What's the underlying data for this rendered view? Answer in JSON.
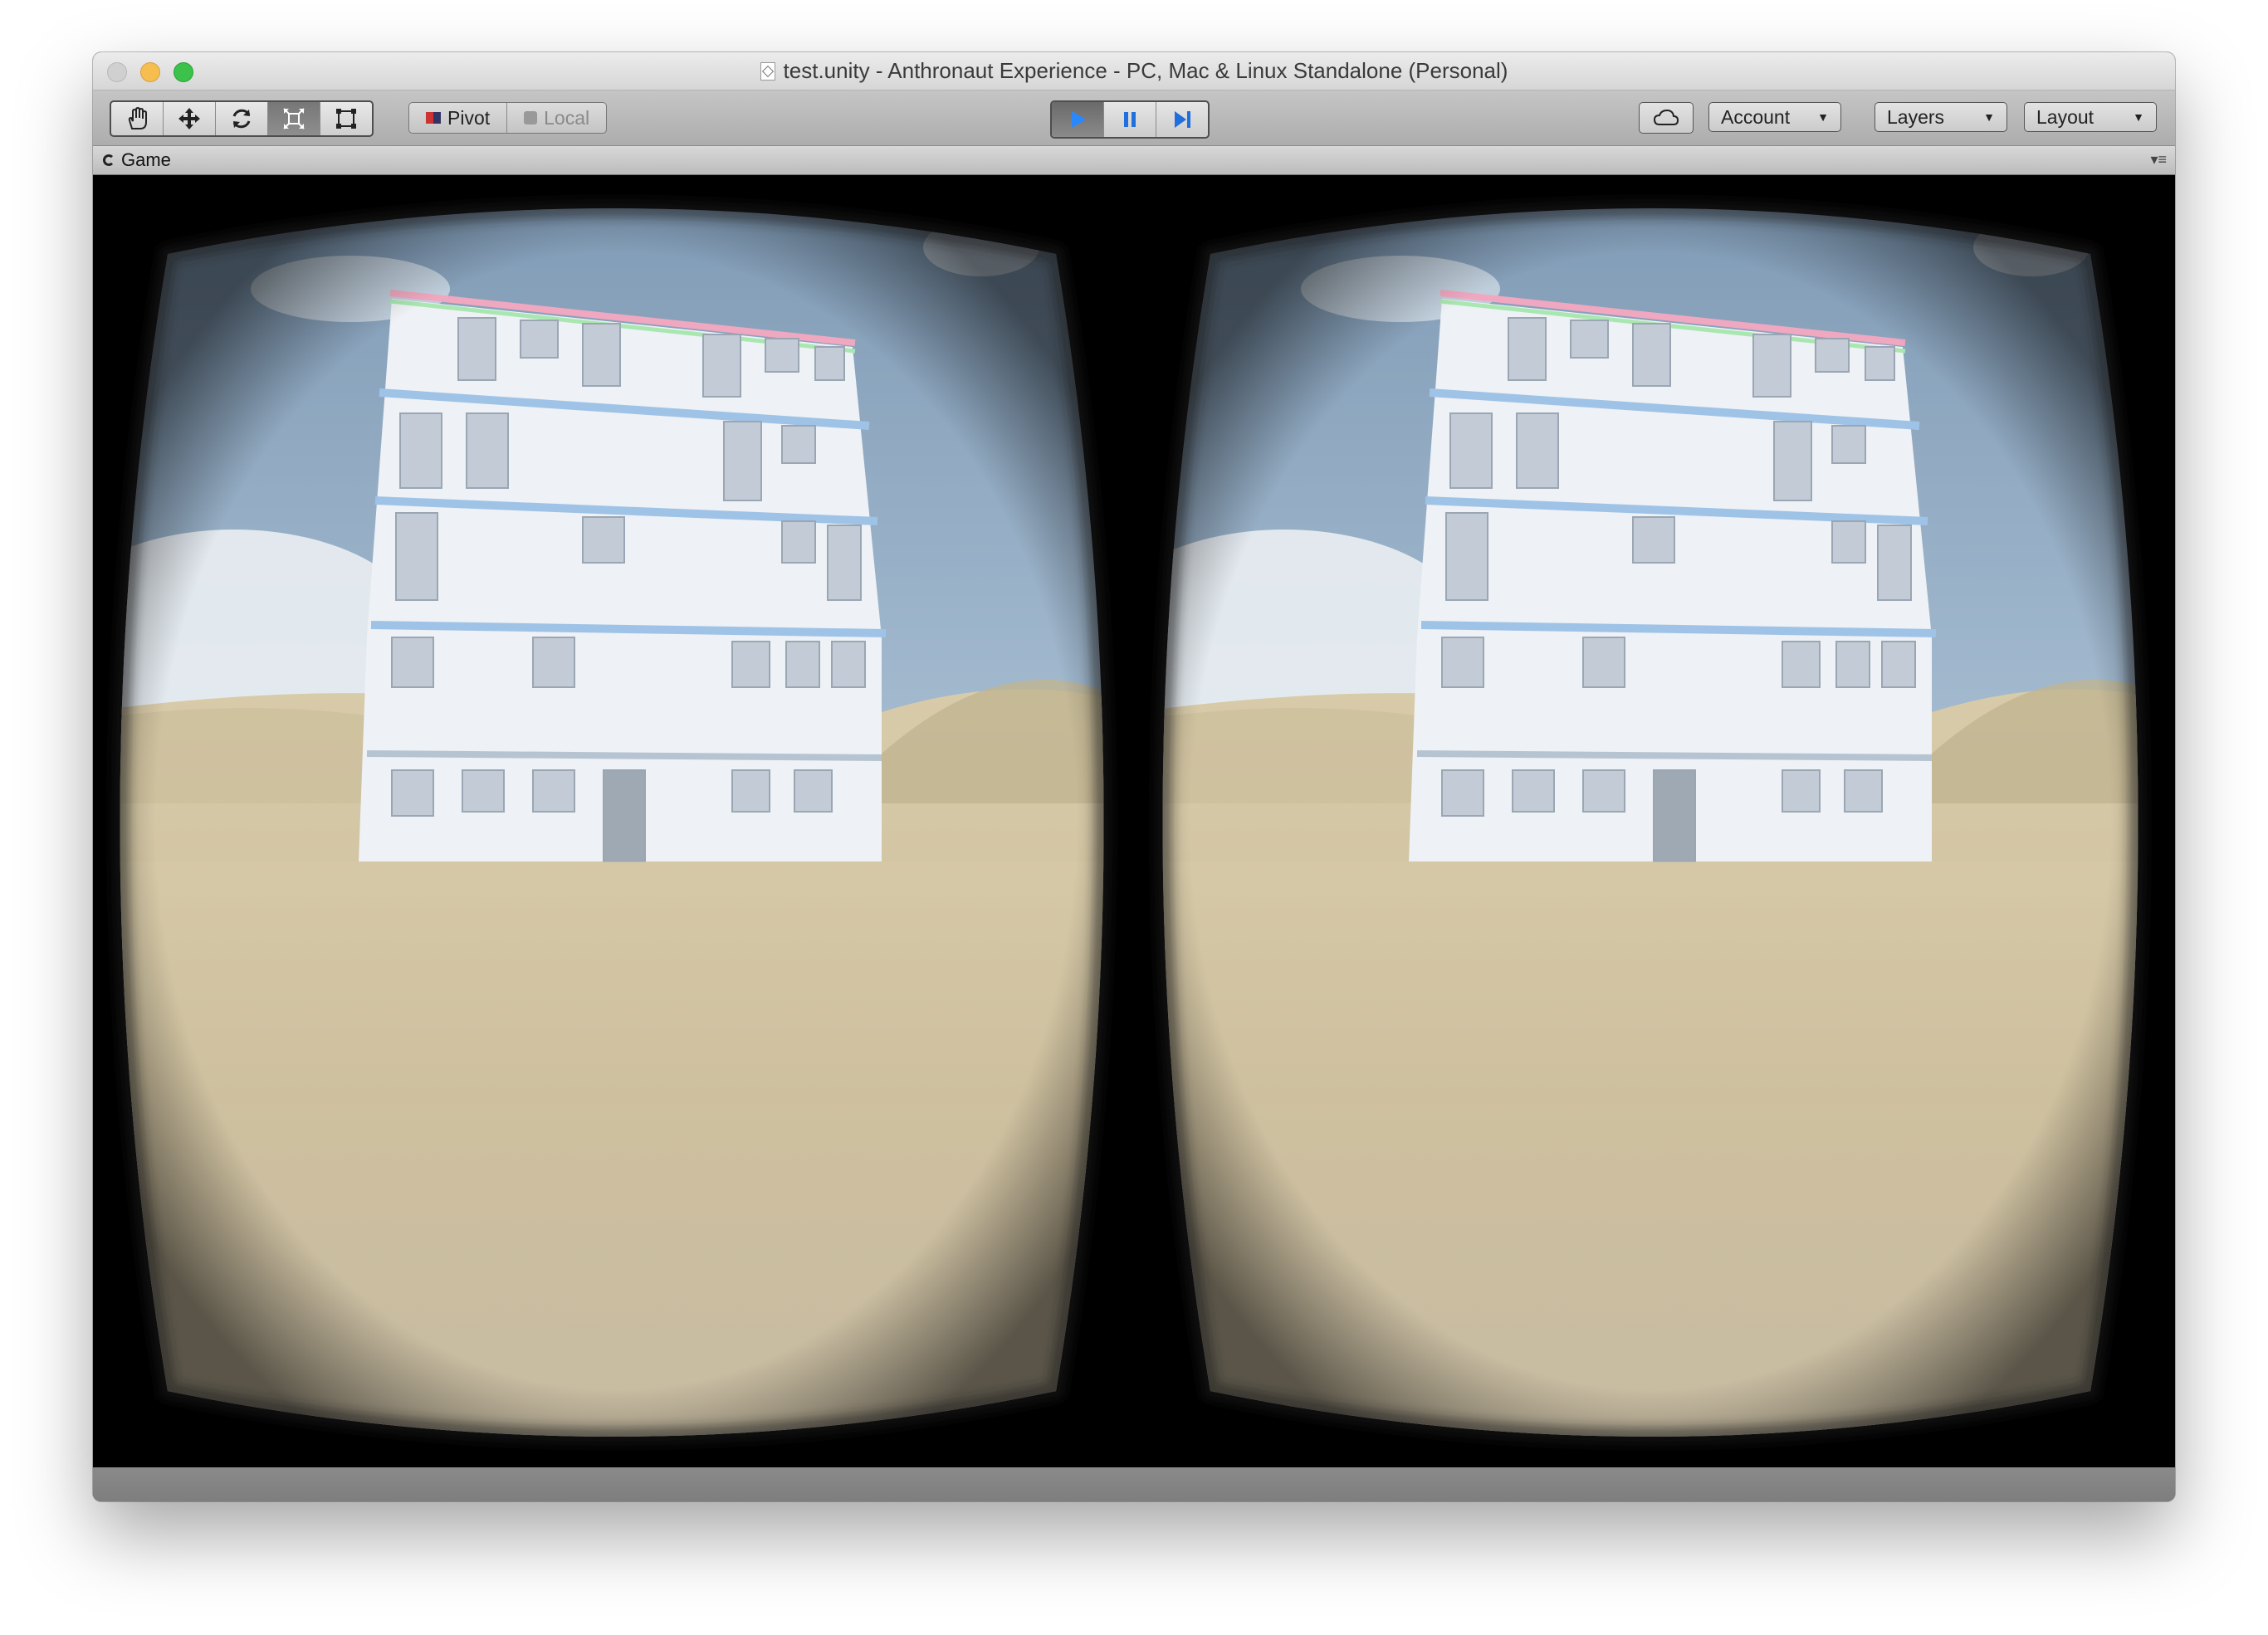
{
  "window": {
    "title": "test.unity - Anthronaut Experience - PC, Mac & Linux Standalone (Personal)"
  },
  "toolbar": {
    "transform_tools": [
      "hand-tool",
      "move-tool",
      "rotate-tool",
      "scale-tool",
      "rect-tool"
    ],
    "pivot_label": "Pivot",
    "local_label": "Local",
    "play_controls": [
      "play",
      "pause",
      "step"
    ],
    "account_label": "Account",
    "layers_label": "Layers",
    "layout_label": "Layout"
  },
  "tab": {
    "game_label": "Game"
  },
  "colors": {
    "sky": "#9fb7cf",
    "sand": "#d9ccaa",
    "building": "#e9edf2",
    "play_blue": "#2a88ff"
  }
}
